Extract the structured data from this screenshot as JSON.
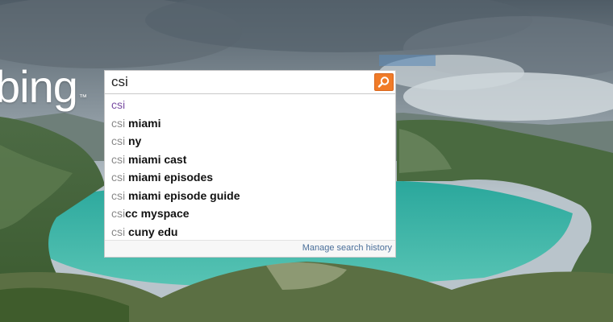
{
  "logo": {
    "text": "bing",
    "mark": "™"
  },
  "search": {
    "value": "csi",
    "button_icon": "search-icon"
  },
  "suggestions": [
    {
      "prefix": "csi",
      "suffix": ""
    },
    {
      "prefix": "csi ",
      "suffix": "miami"
    },
    {
      "prefix": "csi ",
      "suffix": "ny"
    },
    {
      "prefix": "csi ",
      "suffix": "miami cast"
    },
    {
      "prefix": "csi ",
      "suffix": "miami episodes"
    },
    {
      "prefix": "csi ",
      "suffix": "miami episode guide"
    },
    {
      "prefix": "csi",
      "suffix": "cc myspace"
    },
    {
      "prefix": "csi ",
      "suffix": "cuny edu"
    }
  ],
  "footer": {
    "manage_link": "Manage search history"
  },
  "colors": {
    "search_button": "#f07b28",
    "first_suggestion": "#7a4ea3",
    "link": "#4a6f9a"
  }
}
